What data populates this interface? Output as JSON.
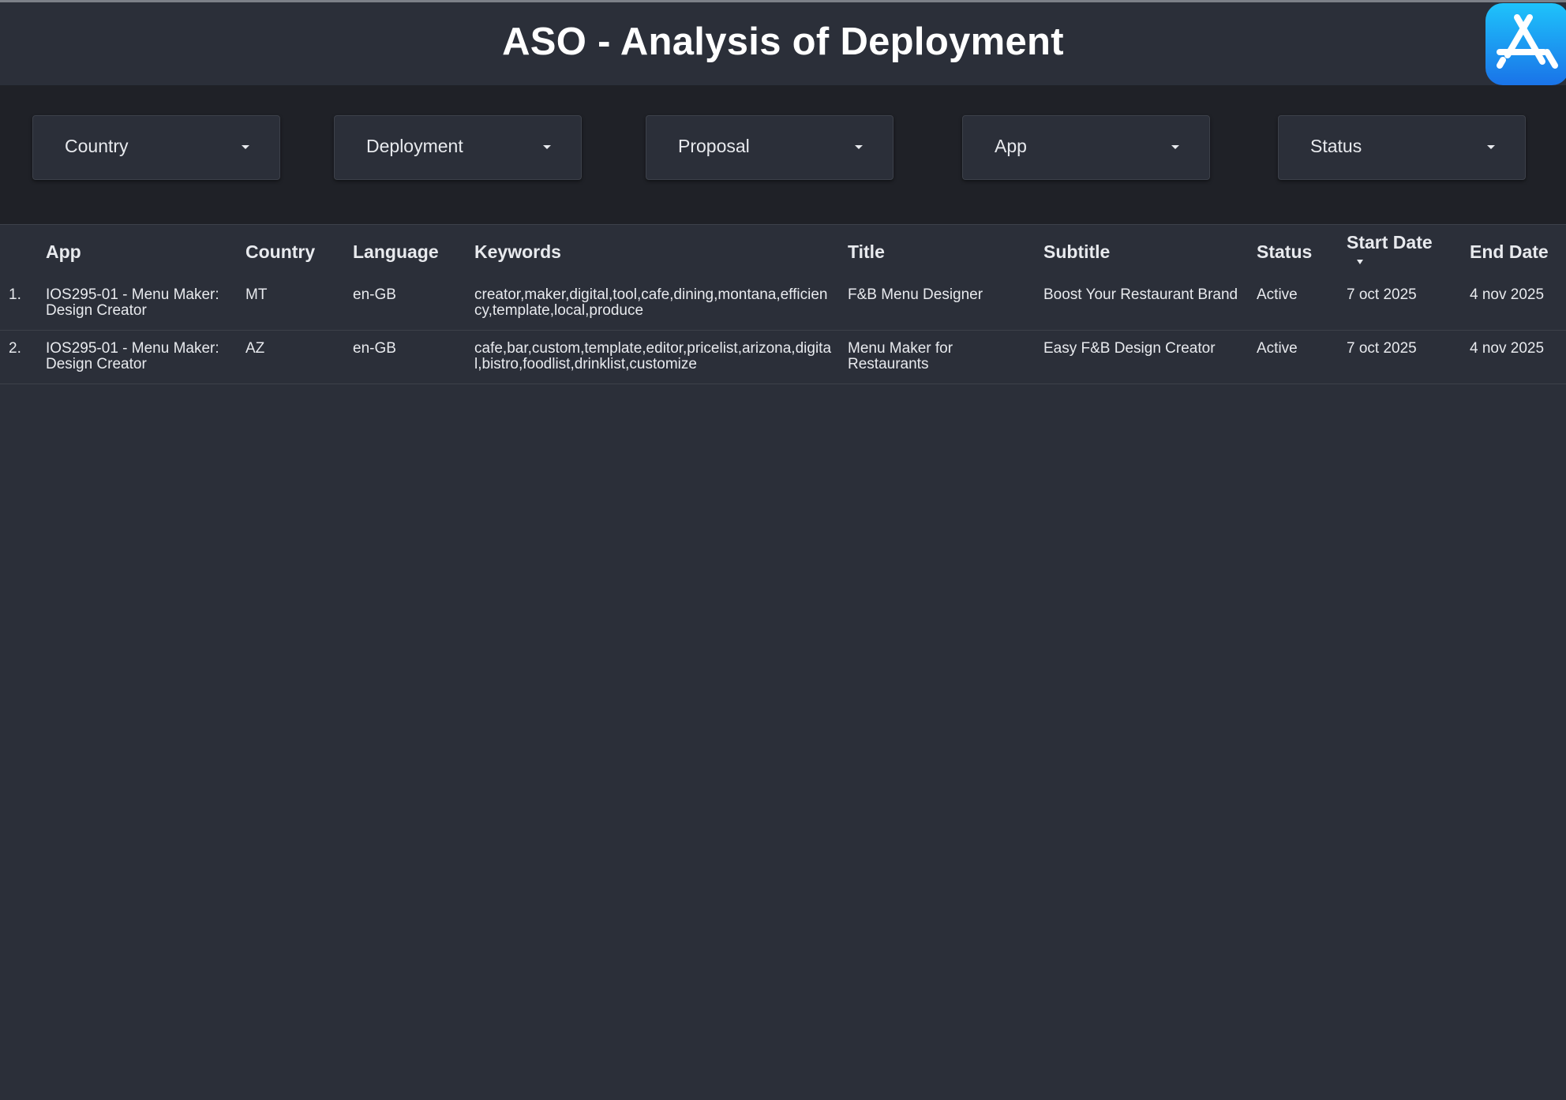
{
  "header": {
    "title": "ASO - Analysis of Deployment",
    "logo_icon": "app-store-icon"
  },
  "filters": [
    {
      "label": "Country"
    },
    {
      "label": "Deployment"
    },
    {
      "label": "Proposal"
    },
    {
      "label": "App"
    },
    {
      "label": "Status"
    }
  ],
  "table": {
    "columns": [
      "App",
      "Country",
      "Language",
      "Keywords",
      "Title",
      "Subtitle",
      "Status",
      "Start Date",
      "End Date"
    ],
    "sorted_column": "Start Date",
    "sort_direction": "descending",
    "rows": [
      {
        "index": "1.",
        "app": "IOS295-01 - Menu Maker: Design Creator",
        "country": "MT",
        "language": "en-GB",
        "keywords": "creator,maker,digital,tool,cafe,dining,montana,efficiency,template,local,produce",
        "title": "F&B Menu Designer",
        "subtitle": "Boost Your Restaurant Brand",
        "status": "Active",
        "start_date": "7 oct 2025",
        "end_date": "4 nov 2025"
      },
      {
        "index": "2.",
        "app": "IOS295-01 - Menu Maker: Design Creator",
        "country": "AZ",
        "language": "en-GB",
        "keywords": "cafe,bar,custom,template,editor,pricelist,arizona,digital,bistro,foodlist,drinklist,customize",
        "title": "Menu Maker for Restaurants",
        "subtitle": "Easy F&B Design Creator",
        "status": "Active",
        "start_date": "7 oct 2025",
        "end_date": "4 nov 2025"
      }
    ]
  },
  "colors": {
    "background": "#2b2f39",
    "filter_bar": "#1f2127",
    "text": "#e8eaee",
    "logo_gradient_top": "#1ec3fb",
    "logo_gradient_bottom": "#1a73e8"
  }
}
